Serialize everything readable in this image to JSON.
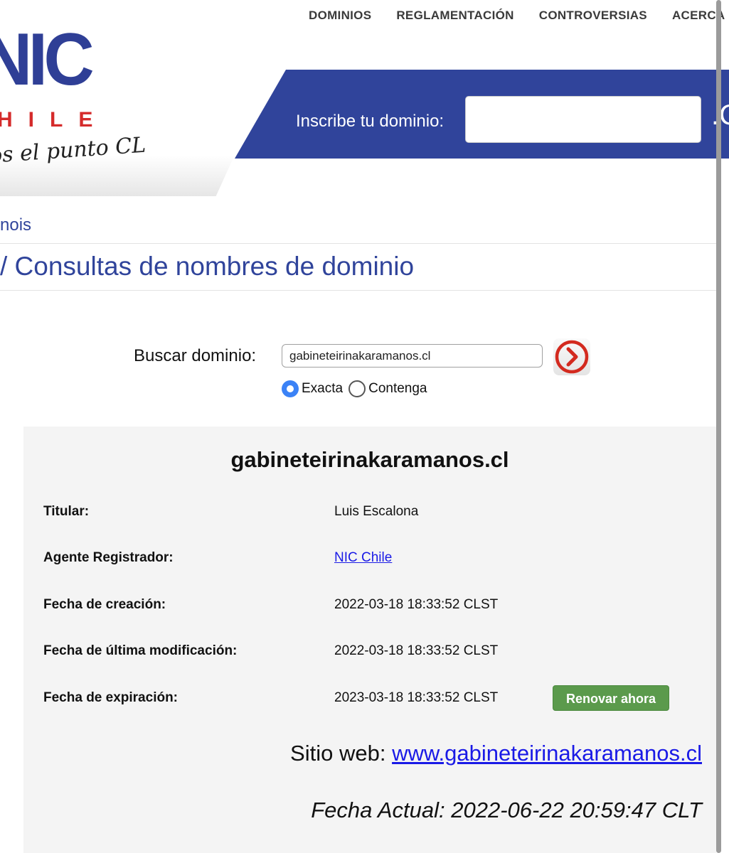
{
  "nav": {
    "items": [
      "DOMINIOS",
      "REGLAMENTACIÓN",
      "CONTROVERSIAS",
      "ACERCA"
    ]
  },
  "logo": {
    "nic": "NIC",
    "chile": "HILE",
    "tagline": "os el punto CL"
  },
  "header": {
    "inscribe_label": "Inscribe tu dominio:",
    "inscribe_value": "",
    "suffix": ".C"
  },
  "breadcrumb": "nois",
  "page_title": "/ Consultas de nombres de dominio",
  "search": {
    "label": "Buscar dominio:",
    "value": "gabineteirinakaramanos.cl",
    "options": [
      "Exacta",
      "Contenga"
    ],
    "selected": "Exacta",
    "go_icon": "chevron-right-circle-icon"
  },
  "result": {
    "domain": "gabineteirinakaramanos.cl",
    "fields": [
      {
        "label": "Titular:",
        "value": "Luis Escalona"
      },
      {
        "label": "Agente Registrador:",
        "value": "NIC Chile"
      },
      {
        "label": "Fecha de creación:",
        "value": "2022-03-18 18:33:52 CLST"
      },
      {
        "label": "Fecha de última modificación:",
        "value": "2022-03-18 18:33:52 CLST"
      },
      {
        "label": "Fecha de expiración:",
        "value": "2023-03-18 18:33:52 CLST"
      }
    ],
    "renew_label": "Renovar ahora",
    "site_prefix": "Sitio web:",
    "site_url": "www.gabineteirinakaramanos.cl",
    "fecha_actual": "Fecha Actual: 2022-06-22 20:59:47 CLT"
  },
  "colors": {
    "brand_blue": "#30449b",
    "brand_red": "#d52b2b",
    "renew_green": "#5b9a4c",
    "link_blue": "#1a1ae6"
  }
}
